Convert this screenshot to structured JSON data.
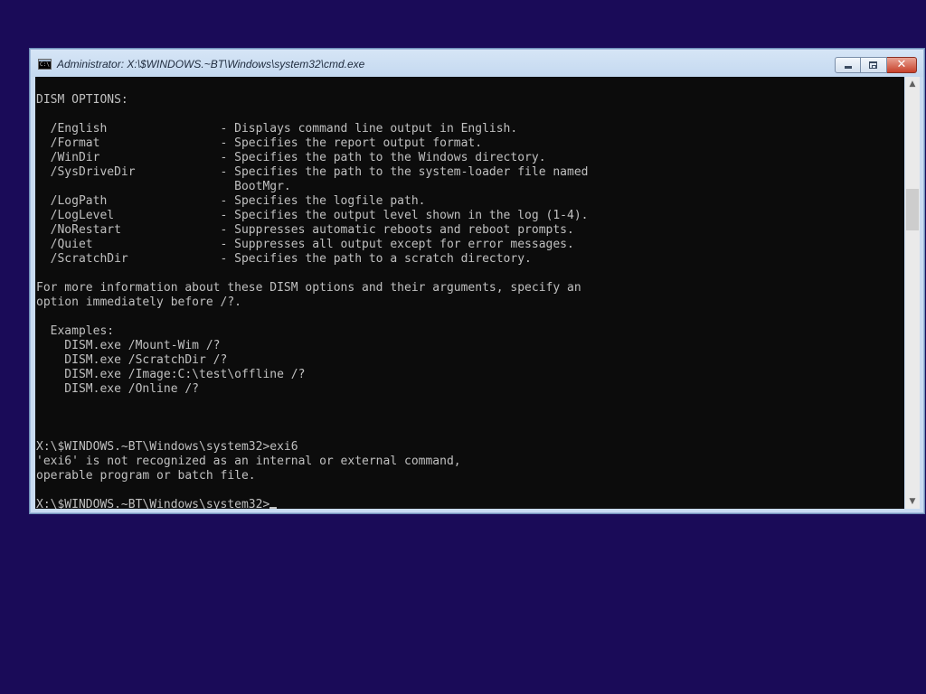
{
  "window": {
    "title": "Administrator: X:\\$WINDOWS.~BT\\Windows\\system32\\cmd.exe",
    "icon": "cmd-console-icon",
    "buttons": {
      "minimize": "minimize-icon",
      "maximize": "maximize-icon",
      "close": "close-icon",
      "close_glyph": "✕"
    }
  },
  "console": {
    "background_color": "#0c0c0c",
    "text_color": "#c0c0c0",
    "lines": [
      "",
      "DISM OPTIONS:",
      "",
      "  /English                - Displays command line output in English.",
      "  /Format                 - Specifies the report output format.",
      "  /WinDir                 - Specifies the path to the Windows directory.",
      "  /SysDriveDir            - Specifies the path to the system-loader file named",
      "                            BootMgr.",
      "  /LogPath                - Specifies the logfile path.",
      "  /LogLevel               - Specifies the output level shown in the log (1-4).",
      "  /NoRestart              - Suppresses automatic reboots and reboot prompts.",
      "  /Quiet                  - Suppresses all output except for error messages.",
      "  /ScratchDir             - Specifies the path to a scratch directory.",
      "",
      "For more information about these DISM options and their arguments, specify an",
      "option immediately before /?.",
      "",
      "  Examples:",
      "    DISM.exe /Mount-Wim /?",
      "    DISM.exe /ScratchDir /?",
      "    DISM.exe /Image:C:\\test\\offline /?",
      "    DISM.exe /Online /?",
      "",
      "",
      "",
      "X:\\$WINDOWS.~BT\\Windows\\system32>exi6",
      "'exi6' is not recognized as an internal or external command,",
      "operable program or batch file.",
      ""
    ],
    "prompt": "X:\\$WINDOWS.~BT\\Windows\\system32>"
  },
  "scrollbar": {
    "up_arrow": "▲",
    "down_arrow": "▼",
    "position_fraction": 0.27
  }
}
